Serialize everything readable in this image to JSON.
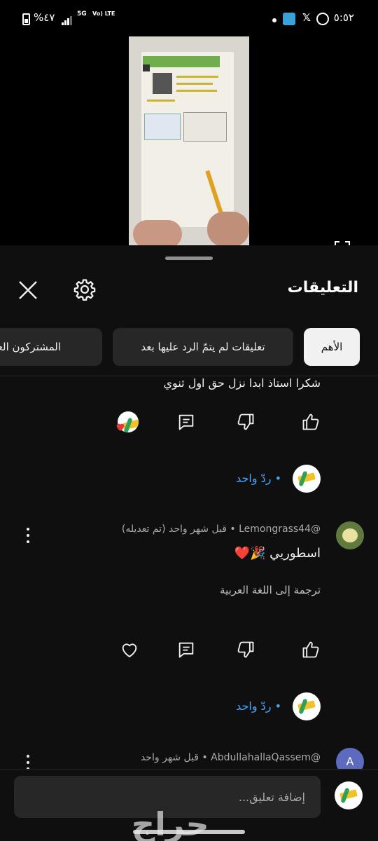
{
  "status_bar": {
    "battery": "%٤٧",
    "network_5g": "5G",
    "network_lte": "Vo) LTE",
    "time": "٥:٥٢",
    "x_app": "𝕏"
  },
  "panel": {
    "title": "التعليقات"
  },
  "chips": [
    {
      "label": "الأهم",
      "selected": true
    },
    {
      "label": "تعليقات لم يتمّ الرد عليها بعد",
      "selected": false
    },
    {
      "label": "المشتركون العلنيون",
      "selected": false
    }
  ],
  "comments": [
    {
      "text": "شكرا استاذ ابدا نزل حق اول ثنوي",
      "reply_label": "• ردّ واحد"
    },
    {
      "author": "@Lemongrass44",
      "age": "• قبل شهر واحد (تم تعديله)",
      "text": "اسطوريي 🎉❤️",
      "translate_label": "ترجمة إلى اللغة العربية",
      "reply_label": "• ردّ واحد"
    },
    {
      "author": "@AbdullahallaQassem",
      "age": "• قبل شهر واحد",
      "avatar_letter": "A"
    }
  ],
  "comment_box": {
    "placeholder": "إضافة تعليق..."
  },
  "watermark": "حراج",
  "colors": {
    "background": "#0f0f0f",
    "chip_selected": "#f1f1f1",
    "chip": "#272727",
    "link": "#3ea6ff",
    "heart": "#e53935"
  }
}
